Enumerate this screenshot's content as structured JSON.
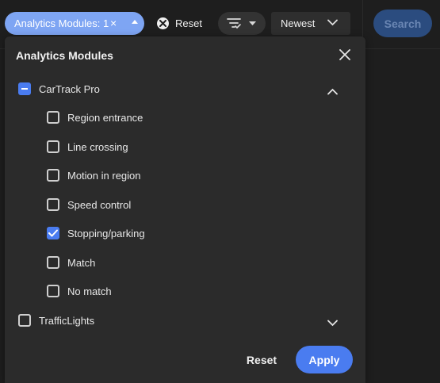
{
  "toolbar": {
    "filter_chip_label": "Analytics Modules: 1",
    "filter_chip_remove": "×",
    "reset_label": "Reset",
    "sort_value": "Newest",
    "search_label": "Search"
  },
  "panel": {
    "title": "Analytics Modules",
    "groups": [
      {
        "label": "CarTrack Pro",
        "state": "mixed",
        "expanded": true,
        "items": [
          {
            "label": "Region entrance",
            "checked": false
          },
          {
            "label": "Line crossing",
            "checked": false
          },
          {
            "label": "Motion in region",
            "checked": false
          },
          {
            "label": "Speed control",
            "checked": false
          },
          {
            "label": "Stopping/parking",
            "checked": true
          },
          {
            "label": "Match",
            "checked": false
          },
          {
            "label": "No match",
            "checked": false
          }
        ]
      },
      {
        "label": "TrafficLights",
        "state": "unchecked",
        "expanded": false,
        "items": []
      }
    ],
    "footer": {
      "reset_label": "Reset",
      "apply_label": "Apply"
    }
  },
  "colors": {
    "accent": "#4a7cf0",
    "chip": "#7ea5f3",
    "panel_bg": "#2b2b2b",
    "page_bg": "#1e1e1e"
  }
}
